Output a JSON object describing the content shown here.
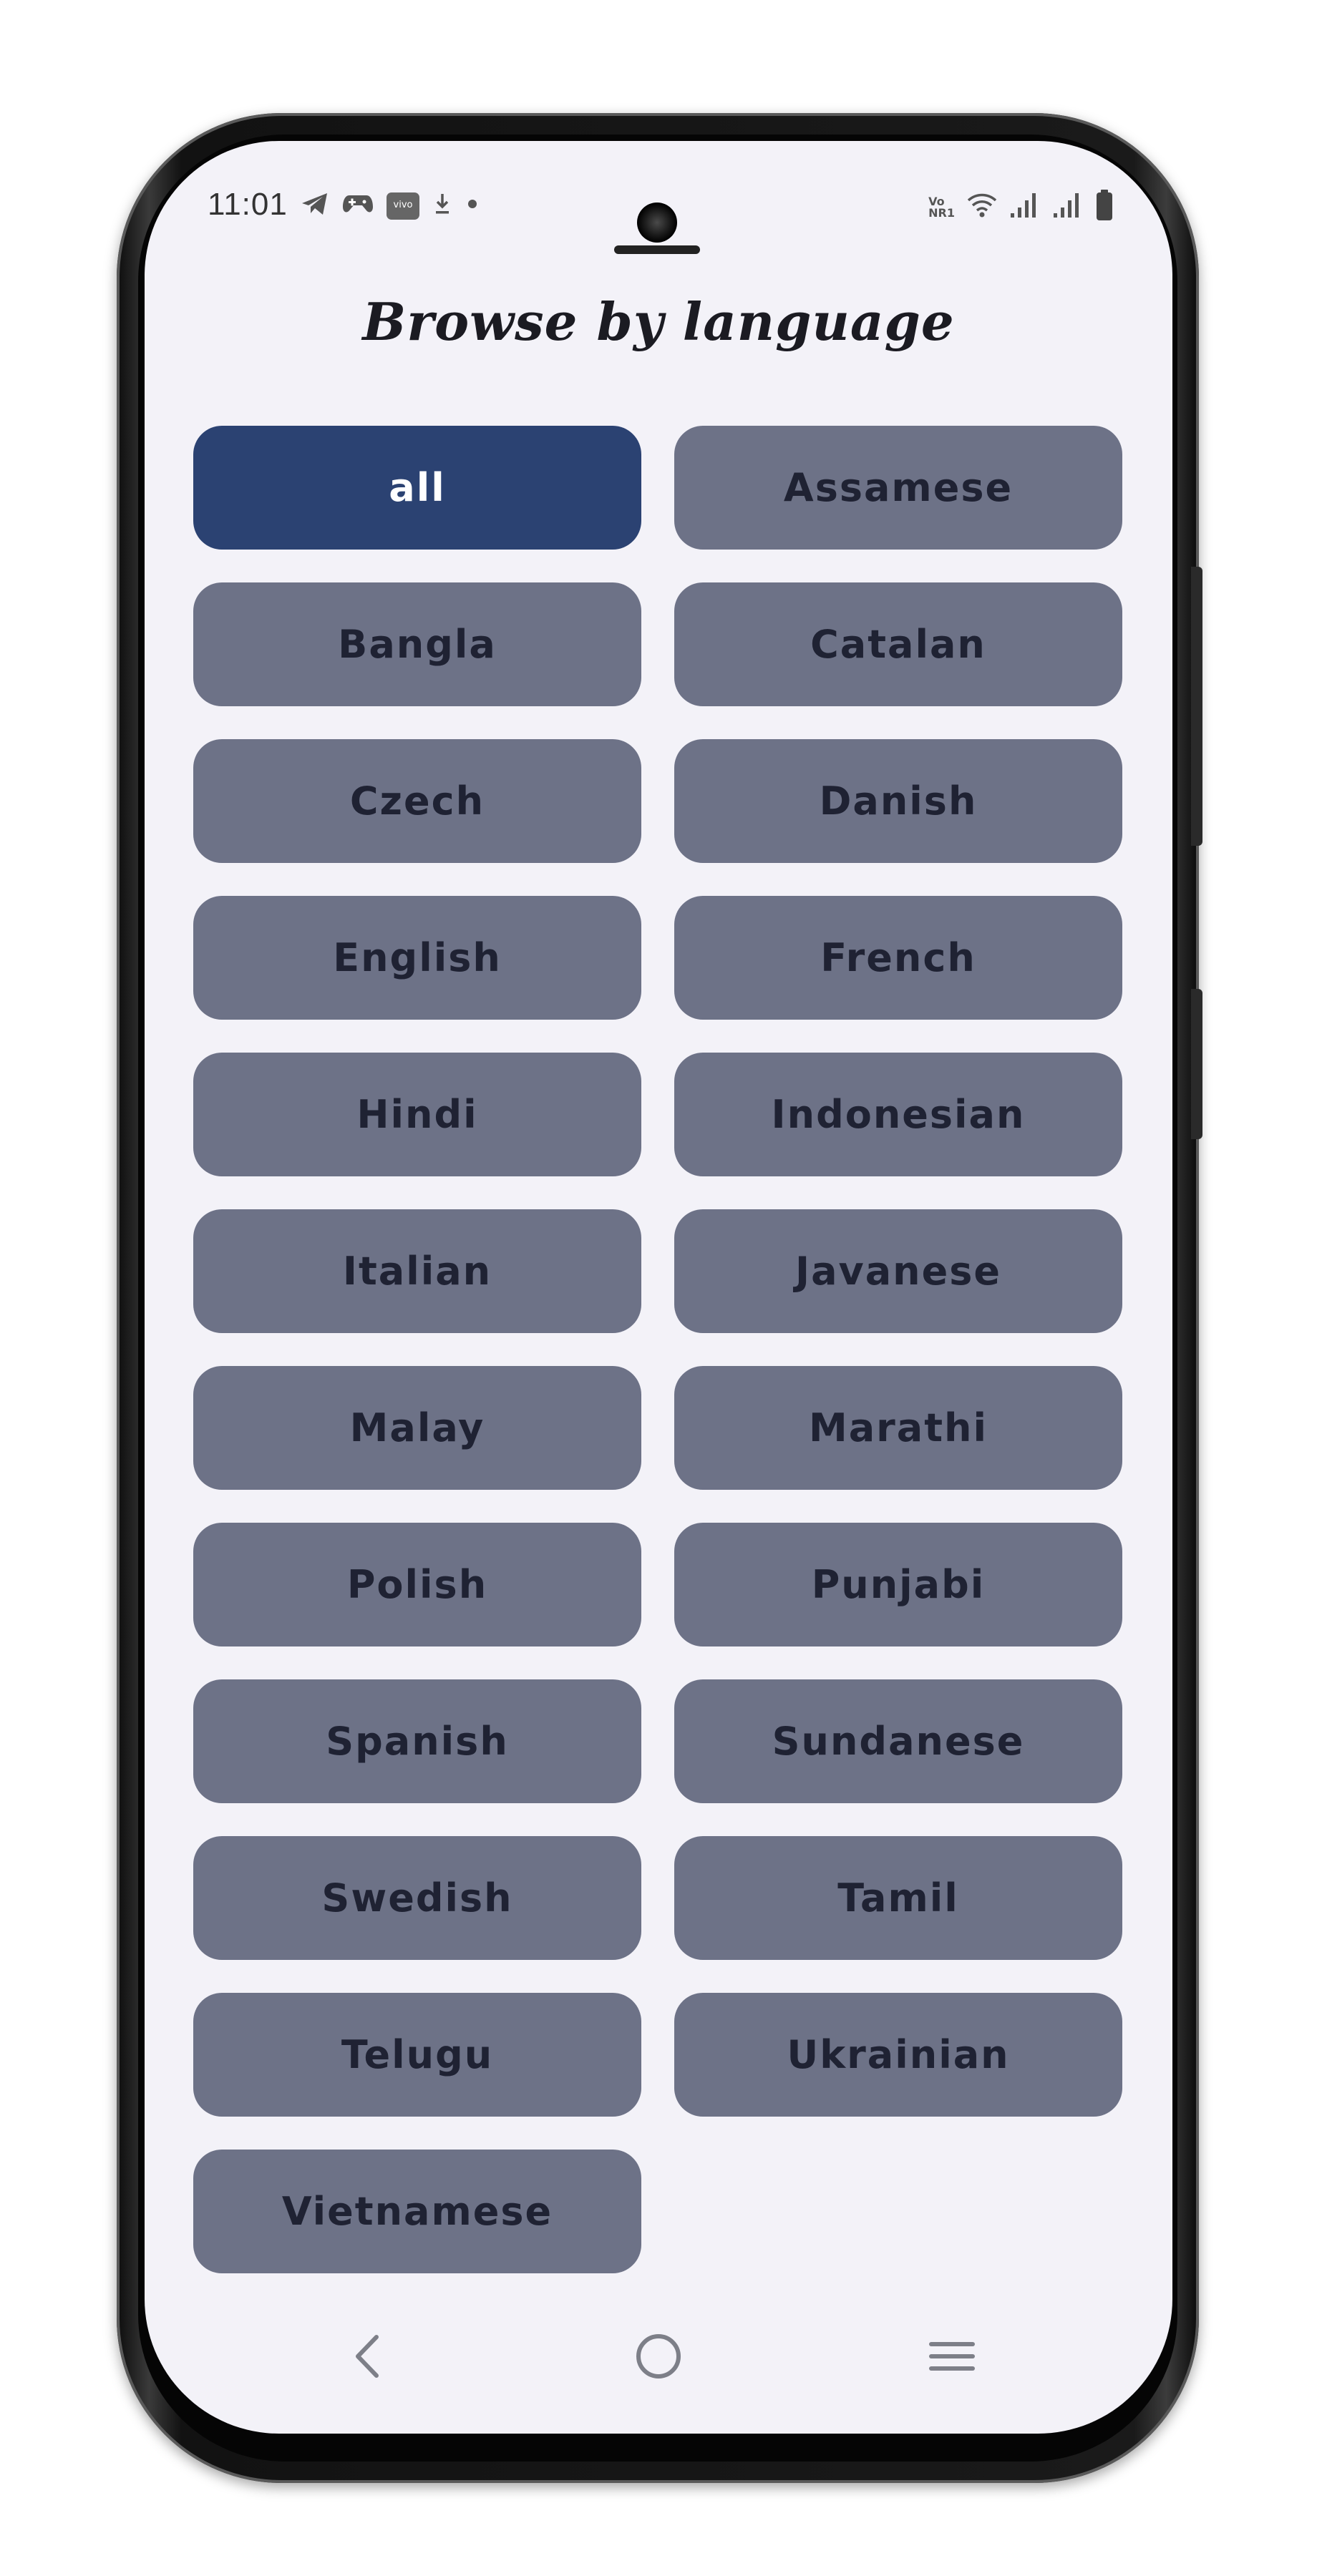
{
  "status_bar": {
    "time": "11:01",
    "left_icons": [
      "telegram-icon",
      "game-controller-icon",
      "vivo-icon",
      "download-icon",
      "dot-icon"
    ],
    "right_icons": [
      "volte-icon",
      "wifi-icon",
      "signal-icon",
      "signal-icon",
      "battery-icon"
    ],
    "volte_text_top": "Vo",
    "volte_text_bottom": "NR1",
    "vivo_label": "vivo"
  },
  "page": {
    "title": "Browse by language"
  },
  "languages": [
    "all",
    "Assamese",
    "Bangla",
    "Catalan",
    "Czech",
    "Danish",
    "English",
    "French",
    "Hindi",
    "Indonesian",
    "Italian",
    "Javanese",
    "Malay",
    "Marathi",
    "Polish",
    "Punjabi",
    "Spanish",
    "Sundanese",
    "Swedish",
    "Tamil",
    "Telugu",
    "Ukrainian",
    "Vietnamese"
  ],
  "selected_language": "all",
  "colors": {
    "screen_bg": "#f3f2f8",
    "button_bg": "#6d7287",
    "button_text": "#1f2233",
    "active_bg": "#2b4272",
    "active_text": "#ffffff"
  },
  "nav_bar": {
    "icons": [
      "back-icon",
      "home-icon",
      "recents-icon"
    ]
  }
}
